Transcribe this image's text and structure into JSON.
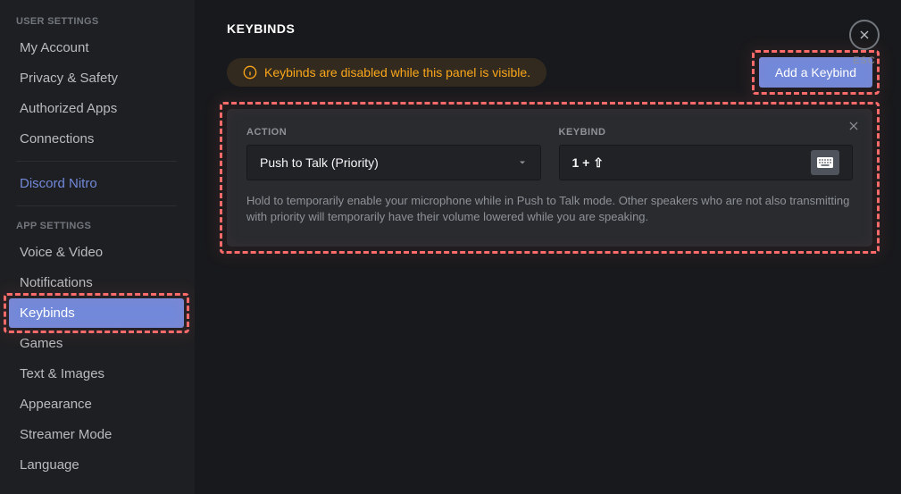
{
  "sidebar": {
    "user_header": "USER SETTINGS",
    "user_items": [
      "My Account",
      "Privacy & Safety",
      "Authorized Apps",
      "Connections",
      "Discord Nitro"
    ],
    "app_header": "APP SETTINGS",
    "app_items": [
      "Voice & Video",
      "Notifications",
      "Keybinds",
      "Games",
      "Text & Images",
      "Appearance",
      "Streamer Mode",
      "Language"
    ],
    "selected": "Keybinds",
    "nitro": "Discord Nitro"
  },
  "page": {
    "title": "KEYBINDS",
    "notice": "Keybinds are disabled while this panel is visible.",
    "add_button": "Add a Keybind"
  },
  "card": {
    "action_label": "ACTION",
    "keybind_label": "KEYBIND",
    "action_value": "Push to Talk (Priority)",
    "keybind_value": "1 + ⇧",
    "description": "Hold to temporarily enable your microphone while in Push to Talk mode. Other speakers who are not also transmitting with priority will temporarily have their volume lowered while you are speaking."
  },
  "esc": {
    "label": "ESC"
  },
  "colors": {
    "accent": "#7289da",
    "warning": "#faa61a",
    "highlight": "#ff6b6b"
  }
}
